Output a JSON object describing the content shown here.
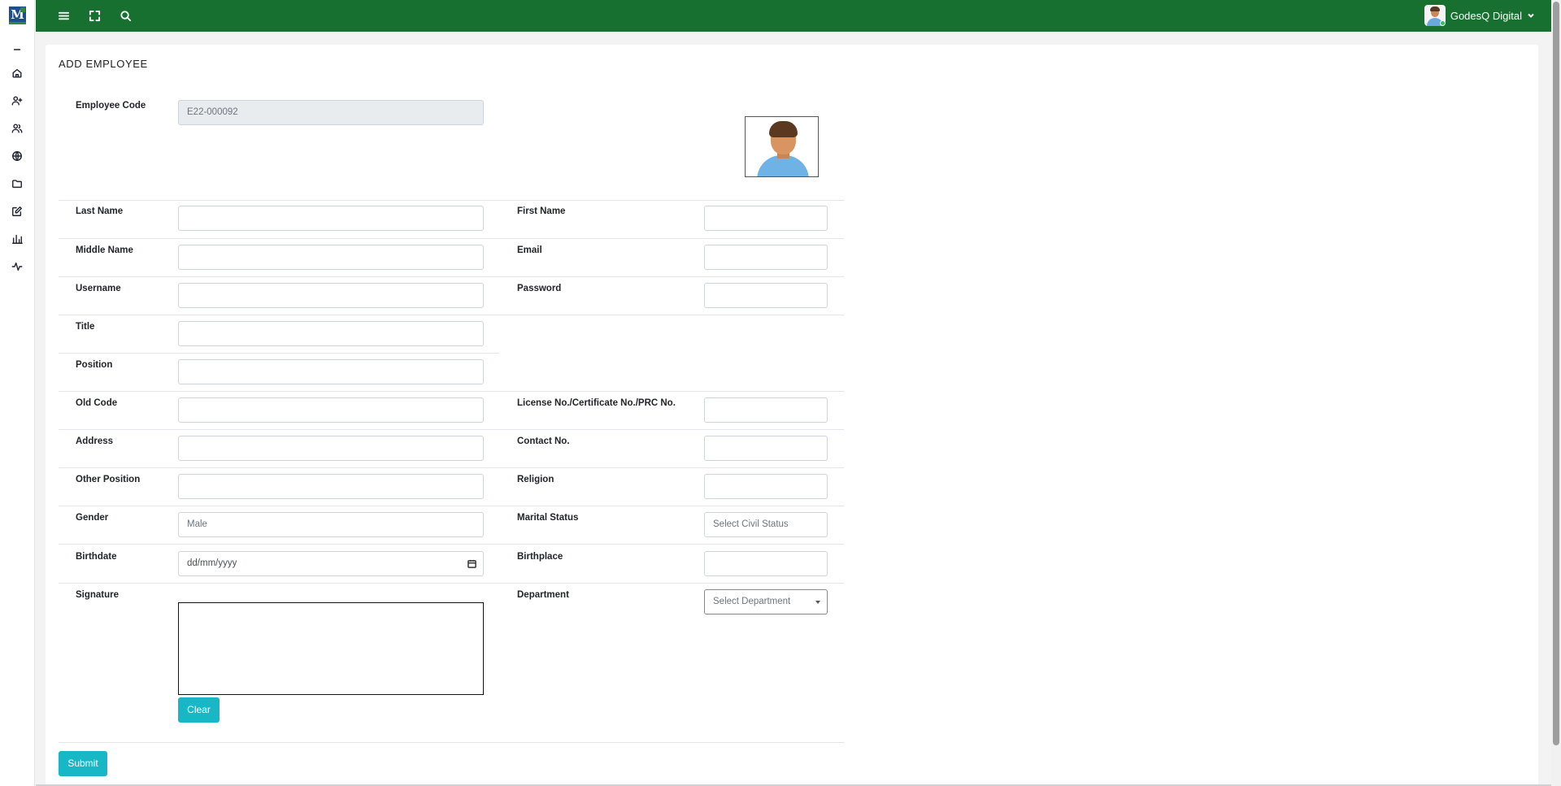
{
  "app": {
    "logo_text": "M"
  },
  "user": {
    "name": "GodesQ Digital"
  },
  "page": {
    "title": "ADD EMPLOYEE"
  },
  "form": {
    "employee_code": {
      "label": "Employee Code",
      "value": "E22-000092"
    },
    "last_name": {
      "label": "Last Name",
      "value": ""
    },
    "first_name": {
      "label": "First Name",
      "value": ""
    },
    "middle_name": {
      "label": "Middle Name",
      "value": ""
    },
    "email": {
      "label": "Email",
      "value": ""
    },
    "username": {
      "label": "Username",
      "value": ""
    },
    "password": {
      "label": "Password",
      "value": ""
    },
    "title": {
      "label": "Title",
      "value": ""
    },
    "position": {
      "label": "Position",
      "value": ""
    },
    "old_code": {
      "label": "Old Code",
      "value": ""
    },
    "license": {
      "label": "License No./Certificate No./PRC No.",
      "value": ""
    },
    "address": {
      "label": "Address",
      "value": ""
    },
    "contact": {
      "label": "Contact No.",
      "value": ""
    },
    "other_position": {
      "label": "Other Position",
      "value": ""
    },
    "religion": {
      "label": "Religion",
      "value": ""
    },
    "gender": {
      "label": "Gender",
      "value": "Male"
    },
    "marital_status": {
      "label": "Marital Status",
      "placeholder": "Select Civil Status"
    },
    "birthdate": {
      "label": "Birthdate",
      "placeholder": "dd/mm/yyyy"
    },
    "birthplace": {
      "label": "Birthplace",
      "value": ""
    },
    "signature": {
      "label": "Signature"
    },
    "department": {
      "label": "Department",
      "placeholder": "Select Department"
    }
  },
  "buttons": {
    "clear": "Clear",
    "submit": "Submit"
  },
  "icons": {
    "sidebar": [
      "minus-icon",
      "home-icon",
      "user-plus-icon",
      "users-icon",
      "globe-icon",
      "folder-icon",
      "edit-icon",
      "bar-chart-icon",
      "activity-icon"
    ],
    "topbar": [
      "menu-icon",
      "fullscreen-icon",
      "search-icon",
      "chevron-down-icon"
    ]
  },
  "colors": {
    "topbar": "#17702f",
    "button": "#17b7c5"
  }
}
